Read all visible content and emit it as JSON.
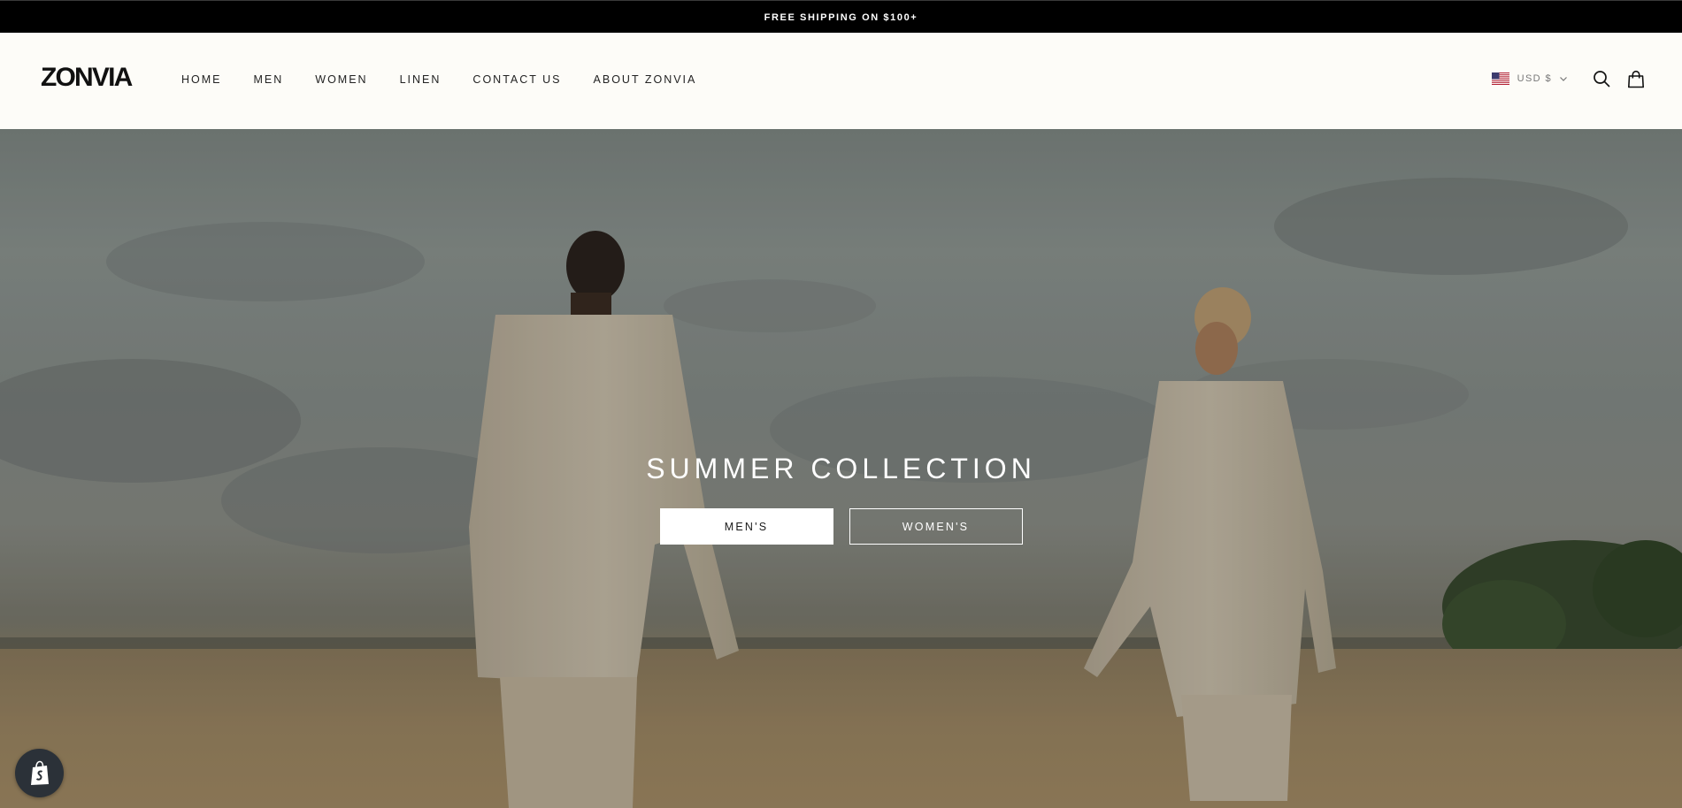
{
  "announcement": {
    "text": "FREE SHIPPING ON $100+"
  },
  "header": {
    "logo": "ZONVIA",
    "nav": [
      {
        "label": "HOME"
      },
      {
        "label": "MEN"
      },
      {
        "label": "WOMEN"
      },
      {
        "label": "LINEN"
      },
      {
        "label": "CONTACT US"
      },
      {
        "label": "ABOUT ZONVIA"
      }
    ],
    "currency": {
      "label": "USD $",
      "flag": "us-flag-icon"
    },
    "icons": [
      "search-icon",
      "shopping-bag-icon"
    ]
  },
  "hero": {
    "title": "SUMMER COLLECTION",
    "buttons": [
      {
        "label": "MEN'S",
        "style": "solid"
      },
      {
        "label": "WOMEN'S",
        "style": "outline"
      }
    ]
  },
  "badge": {
    "icon": "shopify-bag-icon"
  },
  "colors": {
    "announcement_bg": "#000000",
    "header_bg": "#fdfcf8",
    "text_dark": "#222222",
    "hero_button_bg": "#ffffff"
  }
}
